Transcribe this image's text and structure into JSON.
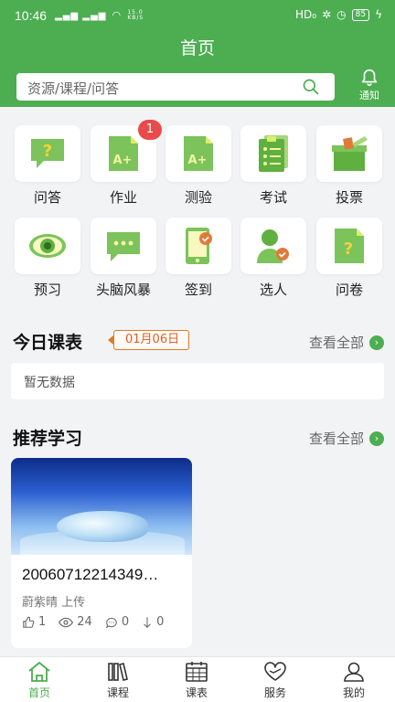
{
  "status_bar": {
    "time": "10:46",
    "signal": "▂▄▆ ▂▄▆",
    "speed_top": "15.0",
    "speed_bottom": "KB/S",
    "hd": "HD₀",
    "battery": "85"
  },
  "header": {
    "title": "首页",
    "search_placeholder": "资源/课程/问答",
    "notify_label": "通知"
  },
  "colors": {
    "primary": "#4cae51",
    "badge": "#e94a4a",
    "date_tag": "#e07a2b"
  },
  "grid": [
    {
      "label": "问答",
      "icon": "qa-icon"
    },
    {
      "label": "作业",
      "icon": "homework-icon",
      "badge": "1"
    },
    {
      "label": "测验",
      "icon": "quiz-icon"
    },
    {
      "label": "考试",
      "icon": "exam-icon"
    },
    {
      "label": "投票",
      "icon": "vote-icon"
    },
    {
      "label": "预习",
      "icon": "preview-icon"
    },
    {
      "label": "头脑风暴",
      "icon": "brainstorm-icon"
    },
    {
      "label": "签到",
      "icon": "checkin-icon"
    },
    {
      "label": "选人",
      "icon": "pick-person-icon"
    },
    {
      "label": "问卷",
      "icon": "survey-icon"
    }
  ],
  "today_schedule": {
    "title": "今日课表",
    "date": "01月06日",
    "view_all": "查看全部",
    "empty_text": "暂无数据"
  },
  "recommended": {
    "title": "推荐学习",
    "view_all": "查看全部",
    "items": [
      {
        "title": "20060712214349…",
        "uploader": "蔚紫晴 上传",
        "likes": "1",
        "views": "24",
        "comments": "0",
        "downloads": "0"
      }
    ]
  },
  "bottom_nav": [
    {
      "label": "首页",
      "icon": "home-icon",
      "active": true
    },
    {
      "label": "课程",
      "icon": "courses-icon"
    },
    {
      "label": "课表",
      "icon": "schedule-icon"
    },
    {
      "label": "服务",
      "icon": "service-icon"
    },
    {
      "label": "我的",
      "icon": "profile-icon"
    }
  ]
}
